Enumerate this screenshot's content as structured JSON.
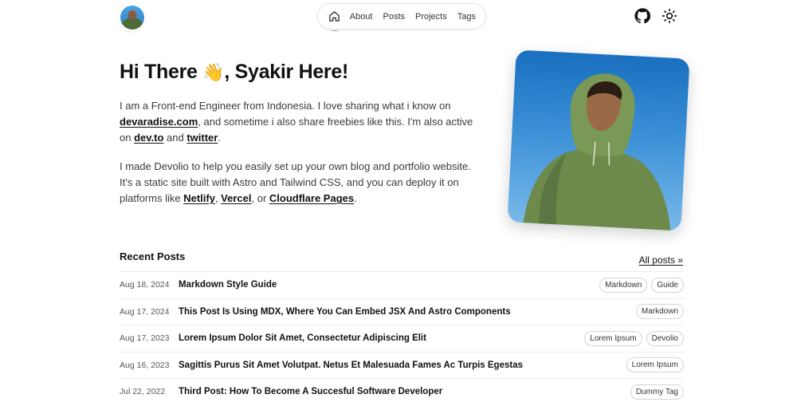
{
  "nav": {
    "items": [
      {
        "label": "About"
      },
      {
        "label": "Posts"
      },
      {
        "label": "Projects"
      },
      {
        "label": "Tags"
      }
    ],
    "icons": [
      "home-icon",
      "github-icon",
      "sun-icon"
    ]
  },
  "hero": {
    "title_before": "Hi There ",
    "wave": "👋",
    "title_after": ", Syakir Here!",
    "p1": {
      "t1": "I am a Front-end Engineer from Indonesia. I love sharing what i know on ",
      "l1": "devaradise.com",
      "t2": ", and sometime i also share freebies like this. I'm also active on ",
      "l2": "dev.to",
      "t3": " and ",
      "l3": "twitter",
      "t4": "."
    },
    "p2": {
      "t1": "I made Devolio to help you easily set up your own blog and portfolio website. It's a static site built with Astro and Tailwind CSS, and you can deploy it on platforms like ",
      "l1": "Netlify",
      "t2": ", ",
      "l2": "Vercel",
      "t3": ", or ",
      "l3": "Cloudflare Pages",
      "t4": "."
    }
  },
  "recent": {
    "heading": "Recent Posts",
    "all_link": "All posts »",
    "posts": [
      {
        "date": "Aug 18, 2024",
        "title": "Markdown Style Guide",
        "tags": [
          "Markdown",
          "Guide"
        ]
      },
      {
        "date": "Aug 17, 2024",
        "title": "This Post Is Using MDX, Where You Can Embed JSX And Astro Components",
        "tags": [
          "Markdown"
        ]
      },
      {
        "date": "Aug 17, 2023",
        "title": "Lorem Ipsum Dolor Sit Amet, Consectetur Adipiscing Elit",
        "tags": [
          "Lorem Ipsum",
          "Devolio"
        ]
      },
      {
        "date": "Aug 16, 2023",
        "title": "Sagittis Purus Sit Amet Volutpat. Netus Et Malesuada Fames Ac Turpis Egestas",
        "tags": [
          "Lorem Ipsum"
        ]
      },
      {
        "date": "Jul 22, 2022",
        "title": "Third Post: How To Become A Succesful Software Developer",
        "tags": [
          "Dummy Tag"
        ]
      }
    ]
  }
}
